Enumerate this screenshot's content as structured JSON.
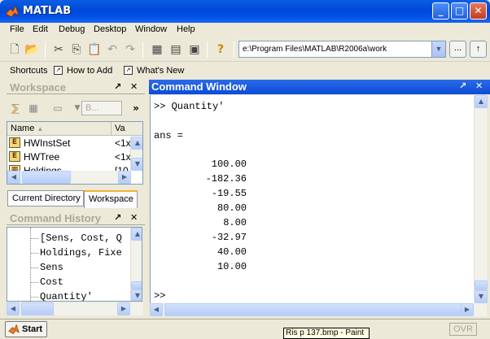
{
  "window": {
    "title": "MATLAB",
    "min": "_",
    "max": "□",
    "close": "✕"
  },
  "menu": [
    "File",
    "Edit",
    "Debug",
    "Desktop",
    "Window",
    "Help"
  ],
  "toolbar": {
    "icons": [
      "new-file-icon",
      "open-folder-icon",
      "cut-icon",
      "copy-icon",
      "paste-icon",
      "undo-icon",
      "redo-icon",
      "simulink-icon",
      "guide-icon",
      "profiler-icon",
      "help-icon"
    ],
    "current_directory": "e:\\Program Files\\MATLAB\\R2006a\\work",
    "browse_label": "...",
    "dropdown_arrow": "▼",
    "up_arrow": "↑"
  },
  "shortcuts": {
    "label": "Shortcuts",
    "items": [
      "How to Add",
      "What's New"
    ]
  },
  "workspace": {
    "title": "Workspace",
    "combo_value": "B...",
    "columns": [
      "Name",
      "Va"
    ],
    "sort_indicator": "▲",
    "rows": [
      {
        "name": "HWInstSet",
        "value": "<1x"
      },
      {
        "name": "HWTree",
        "value": "<1x"
      },
      {
        "name": "Holdings",
        "value": "[10"
      }
    ],
    "tabs": [
      "Current Directory",
      "Workspace"
    ],
    "active_tab": "Workspace"
  },
  "history": {
    "title": "Command History",
    "items": [
      "[Sens, Cost, Q",
      "Holdings, Fixe",
      "Sens",
      "Cost",
      "Quantity'"
    ]
  },
  "command_window": {
    "title": "Command Window",
    "command": ">> Quantity'",
    "ans_label": "ans =",
    "values": [
      "100.00",
      "-182.36",
      "-19.55",
      "80.00",
      "8.00",
      "-32.97",
      "40.00",
      "10.00"
    ],
    "prompt": ">>"
  },
  "statusbar": {
    "start_label": "Start",
    "ovr": "OVR",
    "tooltip": "Ris p 137.bmp - Paint"
  },
  "panel_buttons": {
    "undock": "↗",
    "close": "✕",
    "more": "»"
  }
}
